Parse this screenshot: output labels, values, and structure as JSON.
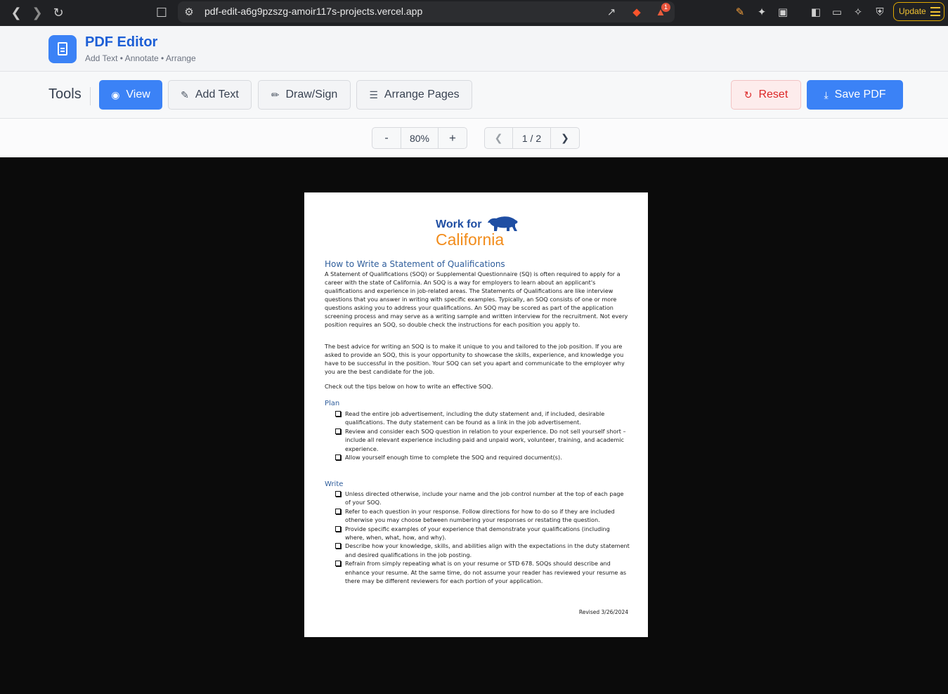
{
  "browser": {
    "url": "pdf-edit-a6g9pzszg-amoir117s-projects.vercel.app",
    "update_label": "Update",
    "badge_count": "1"
  },
  "app": {
    "title": "PDF Editor",
    "subtitle": "Add Text • Annotate • Arrange",
    "brand_color": "#3b82f6"
  },
  "toolbar": {
    "label": "Tools",
    "view": "View",
    "add_text": "Add Text",
    "draw_sign": "Draw/Sign",
    "arrange_pages": "Arrange Pages",
    "reset": "Reset",
    "save_pdf": "Save PDF"
  },
  "controls": {
    "zoom_out": "-",
    "zoom_level": "80%",
    "zoom_in": "+",
    "page_indicator": "1 / 2"
  },
  "document": {
    "logo_line1": "Work for",
    "logo_line2": "California",
    "title": "How to Write a Statement of Qualifications",
    "para1": "A Statement of Qualifications (SOQ) or Supplemental Questionnaire (SQ) is often required to apply for a career with the state of California. An SOQ is a way for employers to learn about an applicant's qualifications and experience in job-related areas. The Statements of Qualifications are like interview questions that you answer in writing with specific examples. Typically, an SOQ consists of one or more questions asking you to address your qualifications. An SOQ may be scored as part of the application screening process and may serve as a writing sample and written interview for the recruitment. Not every position requires an SOQ, so double check the instructions for each position you apply to.",
    "para2": "The best advice for writing an SOQ is to make it unique to you and tailored to the job position. If you are asked to provide an SOQ, this is your opportunity to showcase the skills, experience, and knowledge you have to be successful in the position. Your SOQ can set you apart and communicate to the employer why you are the best candidate for the job.",
    "para3": "Check out the tips below on how to write an effective SOQ.",
    "plan_heading": "Plan",
    "plan_items": [
      "Read the entire job advertisement, including the duty statement and, if included, desirable qualifications. The duty statement can be found as a link in the job advertisement.",
      "Review and consider each SOQ question in relation to your experience. Do not sell yourself short – include all relevant experience including paid and unpaid work, volunteer, training, and academic experience.",
      "Allow yourself enough time to complete the SOQ and required document(s)."
    ],
    "write_heading": "Write",
    "write_items": [
      "Unless directed otherwise, include your name and the job control number at the top of each page of your SOQ.",
      "Refer to each question in your response. Follow directions for how to do so if they are included otherwise you may choose between numbering your responses or restating the question.",
      "Provide specific examples of your experience that demonstrate your qualifications (including where, when, what, how, and why).",
      "Describe how your knowledge, skills, and abilities align with the expectations in the duty statement and desired qualifications in the job posting.",
      "Refrain from simply repeating what is on your resume or STD 678. SOQs should describe and enhance your resume. At the same time, do not assume your reader has reviewed your resume as there may be different reviewers for each portion of your application."
    ],
    "revised": "Revised 3/26/2024"
  }
}
